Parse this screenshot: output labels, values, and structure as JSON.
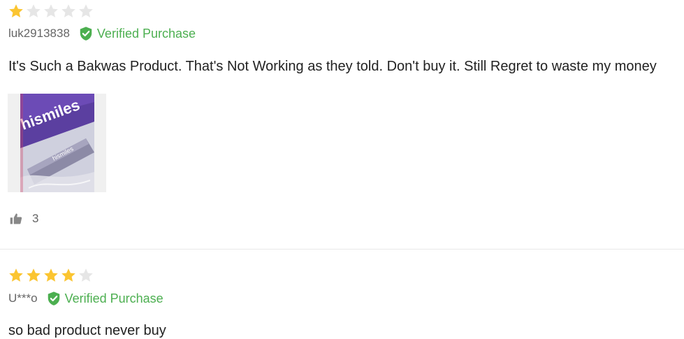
{
  "colors": {
    "star_filled": "#fbc531",
    "star_empty": "#e6e6e6",
    "verified_green": "#4caf50",
    "text_muted": "#666666"
  },
  "reviews": [
    {
      "rating": 1,
      "max_rating": 5,
      "username": "luk2913838",
      "verified_label": "Verified Purchase",
      "text": "It's Such a Bakwas Product. That's Not Working as they told. Don't buy it. Still Regret to waste my money",
      "photo": {
        "brand_text_large": "hismiles",
        "brand_text_small": "hismiles"
      },
      "helpful_count": "3"
    },
    {
      "rating": 4,
      "max_rating": 5,
      "username": "U***o",
      "verified_label": "Verified Purchase",
      "text": "so bad product never buy"
    }
  ]
}
